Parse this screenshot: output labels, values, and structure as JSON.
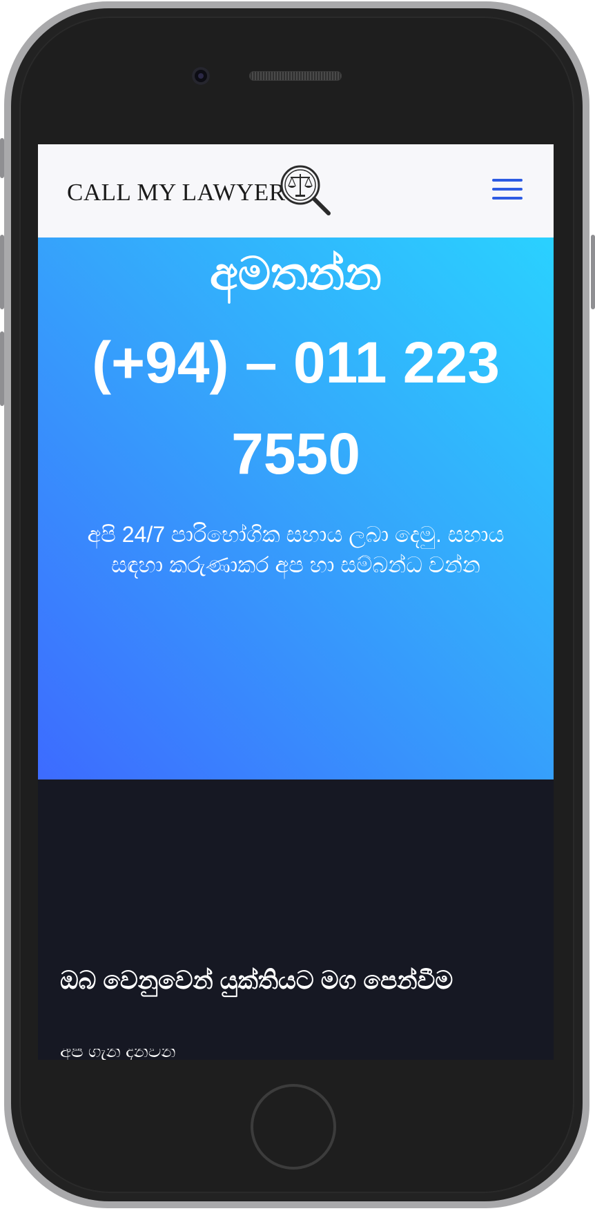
{
  "header": {
    "logo_text": "CALL MY LAWYER",
    "menu_icon": "hamburger-menu-icon"
  },
  "hero": {
    "heading": "අමතන්න",
    "phone": "(+94) – 011 223 7550",
    "subtitle": "අපි 24/7 පාරිභෝගික සහාය ලබා දෙමු. සහාය සඳහා කරුණාකර අප හා සම්බන්ධ වන්න"
  },
  "section": {
    "title": "ඔබ වෙනුවෙන් යුක්තියට මග පෙන්වීම",
    "partial_text": "අපි ගැන දන්වන්"
  },
  "colors": {
    "brand_blue": "#2d5be3",
    "hero_gradient_start": "#2ad1ff",
    "hero_gradient_end": "#3d6bff",
    "dark_bg": "#161823"
  }
}
